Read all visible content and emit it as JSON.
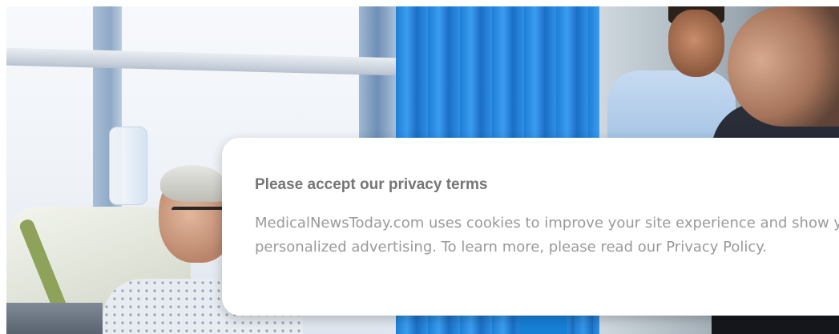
{
  "cookie_dialog": {
    "title": "Please accept our privacy terms",
    "body_text": "MedicalNewsToday.com uses cookies to improve your site experience and show you personalized advertising. To learn more, please read our ",
    "link_text": "Privacy Policy",
    "trailing": "."
  },
  "colors": {
    "dialog_background": "#ffffff",
    "title_text": "#767676",
    "body_text": "#9a9a9a",
    "curtain_blue": "#2f8fe6"
  }
}
